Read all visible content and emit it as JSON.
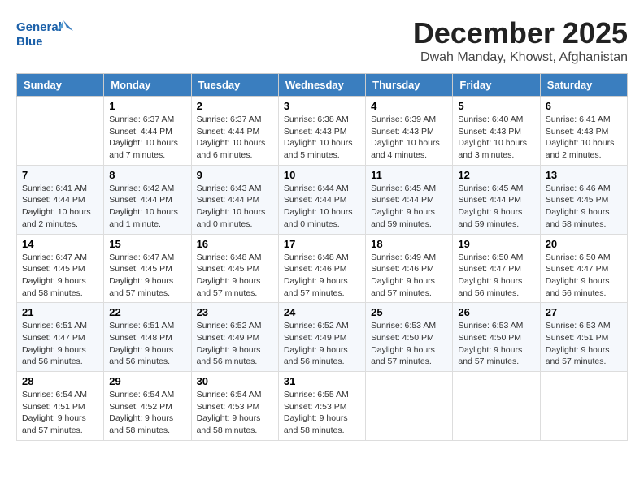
{
  "header": {
    "logo_text_top": "General",
    "logo_text_bottom": "Blue",
    "month": "December 2025",
    "location": "Dwah Manday, Khowst, Afghanistan"
  },
  "weekdays": [
    "Sunday",
    "Monday",
    "Tuesday",
    "Wednesday",
    "Thursday",
    "Friday",
    "Saturday"
  ],
  "weeks": [
    [
      {
        "day": "",
        "text": ""
      },
      {
        "day": "1",
        "text": "Sunrise: 6:37 AM\nSunset: 4:44 PM\nDaylight: 10 hours\nand 7 minutes."
      },
      {
        "day": "2",
        "text": "Sunrise: 6:37 AM\nSunset: 4:44 PM\nDaylight: 10 hours\nand 6 minutes."
      },
      {
        "day": "3",
        "text": "Sunrise: 6:38 AM\nSunset: 4:43 PM\nDaylight: 10 hours\nand 5 minutes."
      },
      {
        "day": "4",
        "text": "Sunrise: 6:39 AM\nSunset: 4:43 PM\nDaylight: 10 hours\nand 4 minutes."
      },
      {
        "day": "5",
        "text": "Sunrise: 6:40 AM\nSunset: 4:43 PM\nDaylight: 10 hours\nand 3 minutes."
      },
      {
        "day": "6",
        "text": "Sunrise: 6:41 AM\nSunset: 4:43 PM\nDaylight: 10 hours\nand 2 minutes."
      }
    ],
    [
      {
        "day": "7",
        "text": "Sunrise: 6:41 AM\nSunset: 4:44 PM\nDaylight: 10 hours\nand 2 minutes."
      },
      {
        "day": "8",
        "text": "Sunrise: 6:42 AM\nSunset: 4:44 PM\nDaylight: 10 hours\nand 1 minute."
      },
      {
        "day": "9",
        "text": "Sunrise: 6:43 AM\nSunset: 4:44 PM\nDaylight: 10 hours\nand 0 minutes."
      },
      {
        "day": "10",
        "text": "Sunrise: 6:44 AM\nSunset: 4:44 PM\nDaylight: 10 hours\nand 0 minutes."
      },
      {
        "day": "11",
        "text": "Sunrise: 6:45 AM\nSunset: 4:44 PM\nDaylight: 9 hours\nand 59 minutes."
      },
      {
        "day": "12",
        "text": "Sunrise: 6:45 AM\nSunset: 4:44 PM\nDaylight: 9 hours\nand 59 minutes."
      },
      {
        "day": "13",
        "text": "Sunrise: 6:46 AM\nSunset: 4:45 PM\nDaylight: 9 hours\nand 58 minutes."
      }
    ],
    [
      {
        "day": "14",
        "text": "Sunrise: 6:47 AM\nSunset: 4:45 PM\nDaylight: 9 hours\nand 58 minutes."
      },
      {
        "day": "15",
        "text": "Sunrise: 6:47 AM\nSunset: 4:45 PM\nDaylight: 9 hours\nand 57 minutes."
      },
      {
        "day": "16",
        "text": "Sunrise: 6:48 AM\nSunset: 4:45 PM\nDaylight: 9 hours\nand 57 minutes."
      },
      {
        "day": "17",
        "text": "Sunrise: 6:48 AM\nSunset: 4:46 PM\nDaylight: 9 hours\nand 57 minutes."
      },
      {
        "day": "18",
        "text": "Sunrise: 6:49 AM\nSunset: 4:46 PM\nDaylight: 9 hours\nand 57 minutes."
      },
      {
        "day": "19",
        "text": "Sunrise: 6:50 AM\nSunset: 4:47 PM\nDaylight: 9 hours\nand 56 minutes."
      },
      {
        "day": "20",
        "text": "Sunrise: 6:50 AM\nSunset: 4:47 PM\nDaylight: 9 hours\nand 56 minutes."
      }
    ],
    [
      {
        "day": "21",
        "text": "Sunrise: 6:51 AM\nSunset: 4:47 PM\nDaylight: 9 hours\nand 56 minutes."
      },
      {
        "day": "22",
        "text": "Sunrise: 6:51 AM\nSunset: 4:48 PM\nDaylight: 9 hours\nand 56 minutes."
      },
      {
        "day": "23",
        "text": "Sunrise: 6:52 AM\nSunset: 4:49 PM\nDaylight: 9 hours\nand 56 minutes."
      },
      {
        "day": "24",
        "text": "Sunrise: 6:52 AM\nSunset: 4:49 PM\nDaylight: 9 hours\nand 56 minutes."
      },
      {
        "day": "25",
        "text": "Sunrise: 6:53 AM\nSunset: 4:50 PM\nDaylight: 9 hours\nand 57 minutes."
      },
      {
        "day": "26",
        "text": "Sunrise: 6:53 AM\nSunset: 4:50 PM\nDaylight: 9 hours\nand 57 minutes."
      },
      {
        "day": "27",
        "text": "Sunrise: 6:53 AM\nSunset: 4:51 PM\nDaylight: 9 hours\nand 57 minutes."
      }
    ],
    [
      {
        "day": "28",
        "text": "Sunrise: 6:54 AM\nSunset: 4:51 PM\nDaylight: 9 hours\nand 57 minutes."
      },
      {
        "day": "29",
        "text": "Sunrise: 6:54 AM\nSunset: 4:52 PM\nDaylight: 9 hours\nand 58 minutes."
      },
      {
        "day": "30",
        "text": "Sunrise: 6:54 AM\nSunset: 4:53 PM\nDaylight: 9 hours\nand 58 minutes."
      },
      {
        "day": "31",
        "text": "Sunrise: 6:55 AM\nSunset: 4:53 PM\nDaylight: 9 hours\nand 58 minutes."
      },
      {
        "day": "",
        "text": ""
      },
      {
        "day": "",
        "text": ""
      },
      {
        "day": "",
        "text": ""
      }
    ]
  ]
}
